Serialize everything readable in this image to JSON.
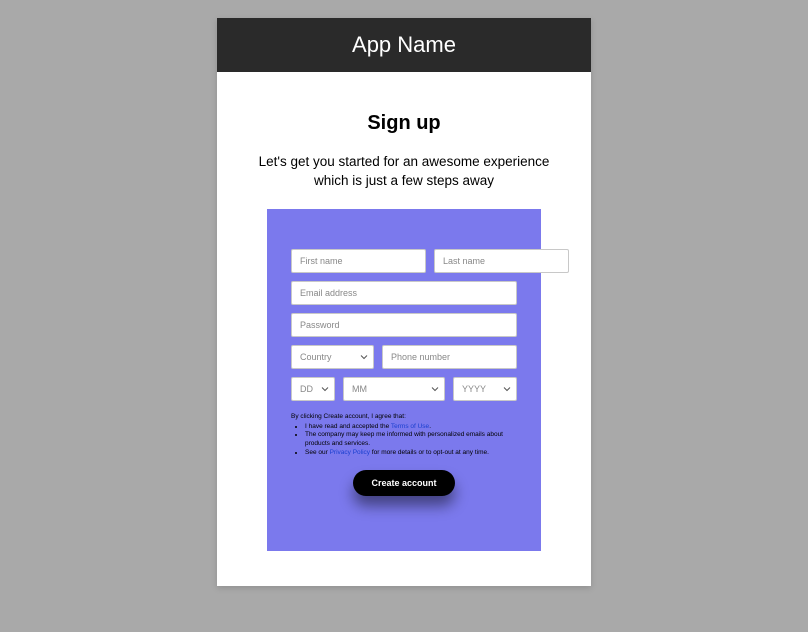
{
  "header": {
    "title": "App Name"
  },
  "page": {
    "title": "Sign up",
    "subtitle_line1": "Let's get you started for an awesome experience",
    "subtitle_line2": "which is just a few steps away"
  },
  "form": {
    "first_name_ph": "First name",
    "last_name_ph": "Last name",
    "email_ph": "Email address",
    "password_ph": "Password",
    "country_ph": "Country",
    "phone_ph": "Phone number",
    "dob_dd_ph": "DD",
    "dob_mm_ph": "MM",
    "dob_yyyy_ph": "YYYY"
  },
  "legal": {
    "intro": "By clicking Create account, I agree that:",
    "item1_prefix": "I have read and accepted the ",
    "item1_link": "Terms of Use",
    "item1_suffix": ".",
    "item2": "The company may keep me informed with personalized  emails about products and services.",
    "item3_prefix": "See our ",
    "item3_link": "Privacy Policy",
    "item3_suffix": " for more details or to opt-out at any time."
  },
  "actions": {
    "create": "Create account"
  },
  "colors": {
    "card_bg": "#7B79ED",
    "header_bg": "#2a2a2a"
  }
}
